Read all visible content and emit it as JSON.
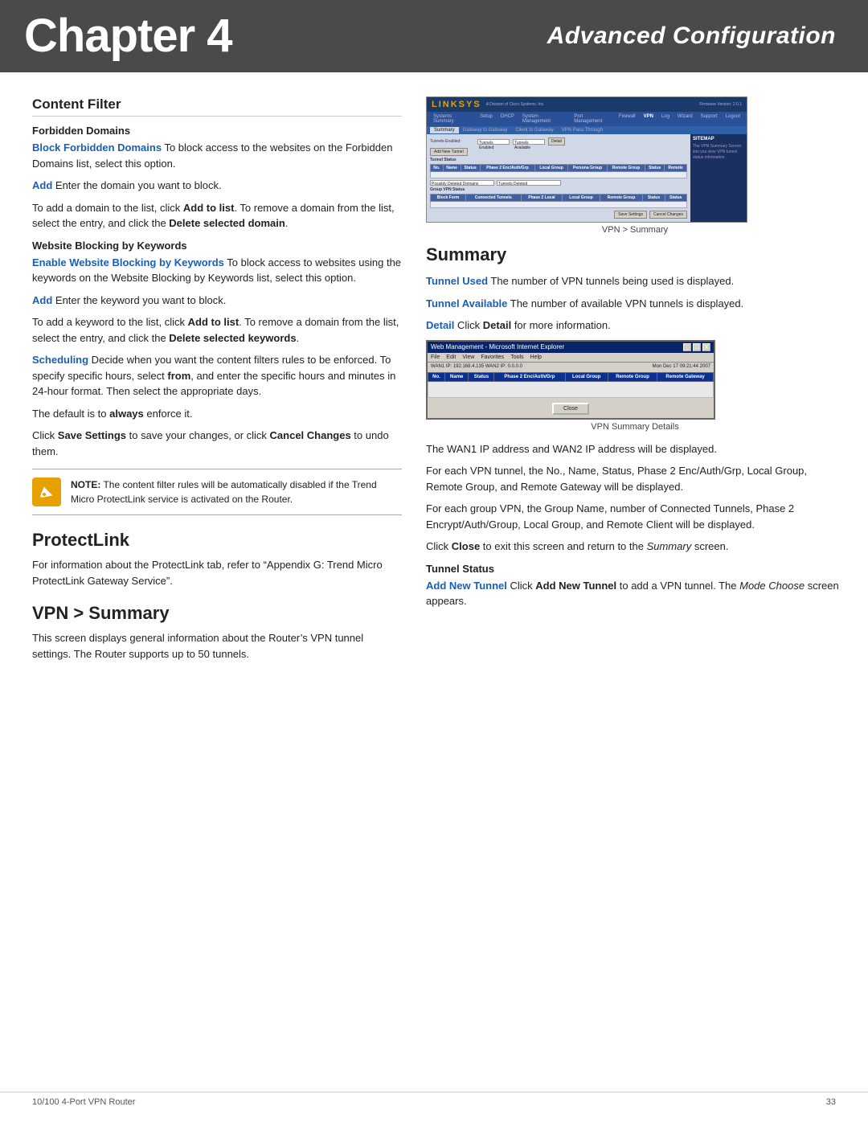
{
  "header": {
    "chapter_label": "Chapter 4",
    "title": "Advanced Configuration"
  },
  "content_filter": {
    "section_title": "Content Filter",
    "forbidden_domains": {
      "subsection_title": "Forbidden Domains",
      "block_label": "Block Forbidden Domains",
      "block_text": " To block access to the websites on the Forbidden Domains list, select this option.",
      "add_label": "Add",
      "add_text": " Enter the domain you want to block.",
      "addtolist_para": "To add a domain to the list, click ",
      "addtolist_bold": "Add to list",
      "addtolist_text": ". To remove a domain from the list, select the entry, and click the ",
      "delete_bold": "Delete selected domain",
      "delete_text": "."
    },
    "website_blocking": {
      "subsection_title": "Website Blocking by Keywords",
      "enable_label": "Enable Website Blocking by Keywords",
      "enable_text": "  To block access to websites using the keywords on the Website Blocking by Keywords list, select this option.",
      "add_label": "Add",
      "add_text": " Enter the keyword you want to block.",
      "addtolist_para": "To add a keyword to the list, click ",
      "addtolist_bold": "Add to list",
      "addtolist_text": ". To remove a domain from the list, select the entry, and click the ",
      "delete_bold": "Delete selected keywords",
      "delete_text": "."
    },
    "scheduling": {
      "label": "Scheduling",
      "text": "  Decide when you want the content filters rules to be enforced. To specify specific hours, select ",
      "from_bold": "from",
      "from_text": ", and enter the specific hours and minutes in 24-hour format. Then select the appropriate days."
    },
    "default_para": "The default is to ",
    "always_bold": "always",
    "always_text": " enforce it.",
    "save_para": "Click ",
    "save_bold": "Save Settings",
    "save_text": " to save your changes, or click ",
    "cancel_bold": "Cancel Changes",
    "cancel_text": " to undo them.",
    "note": {
      "label": "NOTE:",
      "text": " The content filter rules will be automatically disabled if the Trend Micro ProtectLink service is activated on the Router."
    }
  },
  "protectlink": {
    "title": "ProtectLink",
    "text": "For information about the ProtectLink tab, refer to “Appendix G: Trend Micro ProtectLink Gateway Service”."
  },
  "vpn_summary_left": {
    "title": "VPN > Summary",
    "text": "This screen displays general information about the Router’s VPN tunnel settings. The Router supports up to 50 tunnels.",
    "screenshot_label": "VPN > Summary"
  },
  "right_col": {
    "summary": {
      "title": "Summary",
      "tunnel_used_label": "Tunnel Used",
      "tunnel_used_text": "  The number of VPN tunnels being used is displayed.",
      "tunnel_available_label": "Tunnel Available",
      "tunnel_available_text": "  The number of available VPN tunnels is displayed.",
      "detail_label": "Detail",
      "detail_text": "  Click ",
      "detail_bold": "Detail",
      "detail_text2": " for more information.",
      "screenshot_label": "VPN Summary Details",
      "wan1_para": "The WAN1 IP address and WAN2 IP address will be displayed.",
      "vpn_tunnel_para": "For each VPN tunnel, the No., Name, Status, Phase 2 Enc/Auth/Grp, Local Group, Remote Group, and Remote Gateway will be displayed.",
      "group_vpn_para": "For each group VPN, the Group Name, number of Connected Tunnels, Phase 2 Encrypt/Auth/Group, Local Group, and Remote Client will be displayed.",
      "close_para_start": "Click ",
      "close_bold": "Close",
      "close_para_end": " to exit this screen and return to the ",
      "close_italic": "Summary",
      "close_para_final": " screen."
    },
    "tunnel_status": {
      "subsection_title": "Tunnel Status",
      "add_new_label": "Add New Tunnel",
      "add_new_text": " Click ",
      "add_new_bold": "Add New Tunnel",
      "add_new_text2": " to add a VPN tunnel. The ",
      "mode_italic": "Mode Choose",
      "add_new_text3": " screen appears."
    }
  },
  "linksys_screenshot": {
    "logo": "LINKSYS",
    "nav_items": [
      "Systems Summary",
      "Setup",
      "DHCP",
      "System Management",
      "Port Management",
      "Firewall",
      "VPN",
      "Log",
      "Wizard",
      "Support",
      "Logout"
    ],
    "tabs": [
      "Summary",
      "Gateway to Gateway",
      "Client to Gateway",
      "VPN Pass Through"
    ],
    "active_tab": "Summary",
    "section_labels": [
      "Tunnels",
      "Tunnel Status",
      "Group VPN Status"
    ],
    "table_headers": [
      "No.",
      "Name",
      "Status",
      "Phase 2 Enc/Auth/Grp",
      "Local Group",
      "Persona Group",
      "Remote Group",
      "Status",
      "Remote"
    ],
    "sidebar_items": [
      "SITEMAP"
    ]
  },
  "vpn_details_screenshot": {
    "titlebar": "Web Management - Microsoft Internet Explorer",
    "menu_items": [
      "File",
      "Edit",
      "View",
      "Favorites",
      "Tools",
      "Help"
    ],
    "info_left": "WAN1 IP: 192.168.4.135  WAN2 IP: 0.0.0.0",
    "info_right": "Mon Dec 17 09:21:44 2007",
    "table_headers": [
      "No.",
      "Name",
      "Status",
      "Phase 2 Enc/Auth/Grp",
      "Local Group",
      "Remote Group",
      "Remote Gateway"
    ],
    "close_btn": "Close"
  },
  "footer": {
    "left": "10/100 4-Port VPN Router",
    "right": "33"
  }
}
